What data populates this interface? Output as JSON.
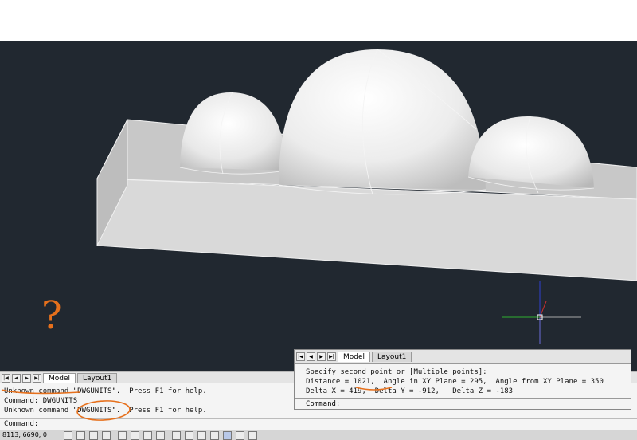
{
  "viewport": {
    "annotation_mark": "?"
  },
  "bottom_tabs": {
    "model": "Model",
    "layout1": "Layout1"
  },
  "command_history": {
    "lines": [
      "Unknown command \"DWGUNITS\".  Press F1 for help.",
      "Command: DWGUNITS",
      "Unknown command \"DWGUNITS\".  Press F1 for help."
    ],
    "prompt": "Command:"
  },
  "status_bar": {
    "coordinates": "8113, 6690, 0"
  },
  "floating_panel": {
    "tabs": {
      "model": "Model",
      "layout1": "Layout1"
    },
    "lines": [
      "Specify second point or [Multiple points]:",
      "Distance = 1021,  Angle in XY Plane = 295,  Angle from XY Plane = 350",
      "Delta X = 419,  Delta Y = -912,   Delta Z = -183"
    ],
    "prompt": "Command:"
  },
  "colors": {
    "viewport_bg": "#212830",
    "annotation": "#e6701c",
    "axis_x": "#d03030",
    "axis_y": "#30b030",
    "axis_z": "#3040d0"
  }
}
